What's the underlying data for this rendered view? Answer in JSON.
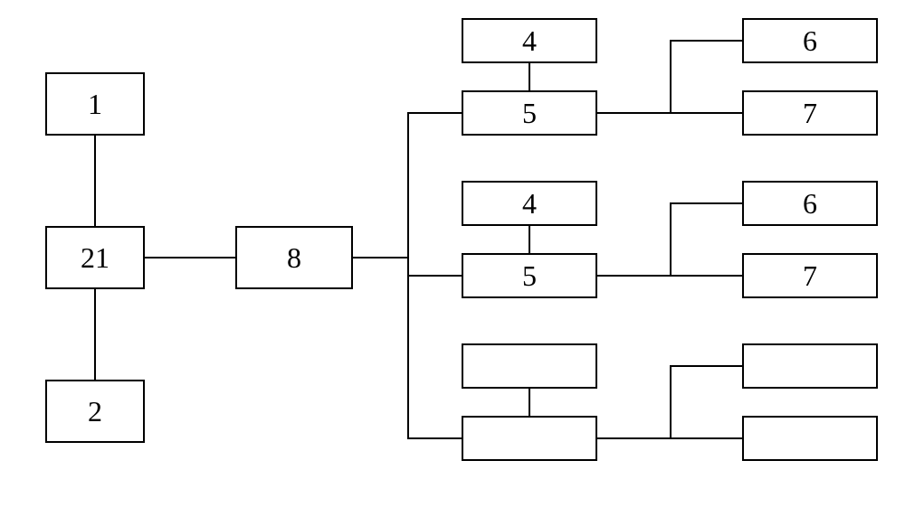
{
  "boxes": {
    "b1": "1",
    "b2": "2",
    "b21": "21",
    "b8": "8",
    "g1_4": "4",
    "g1_5": "5",
    "g1_6": "6",
    "g1_7": "7",
    "g2_4": "4",
    "g2_5": "5",
    "g2_6": "6",
    "g2_7": "7",
    "g3_4": "",
    "g3_5": "",
    "g3_6": "",
    "g3_7": ""
  }
}
